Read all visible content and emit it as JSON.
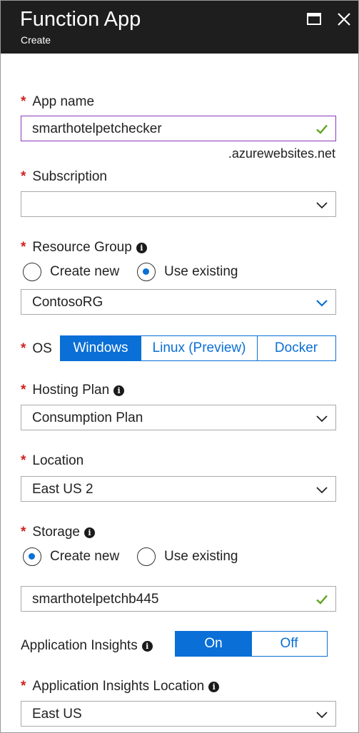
{
  "blade": {
    "title": "Function App",
    "subtitle": "Create"
  },
  "required_marker": "*",
  "info_glyph": "i",
  "app_name": {
    "label": "App name",
    "value": "smarthotelpetchecker",
    "suffix": ".azurewebsites.net"
  },
  "subscription": {
    "label": "Subscription",
    "value": ""
  },
  "resource_group": {
    "label": "Resource Group",
    "options": [
      "Create new",
      "Use existing"
    ],
    "selected": "Use existing",
    "value": "ContosoRG"
  },
  "os": {
    "label": "OS",
    "options": [
      "Windows",
      "Linux (Preview)",
      "Docker"
    ],
    "selected": "Windows"
  },
  "hosting_plan": {
    "label": "Hosting Plan",
    "value": "Consumption Plan"
  },
  "location": {
    "label": "Location",
    "value": "East US 2"
  },
  "storage": {
    "label": "Storage",
    "options": [
      "Create new",
      "Use existing"
    ],
    "selected": "Create new",
    "value": "smarthotelpetchb445"
  },
  "app_insights": {
    "label": "Application Insights",
    "options": [
      "On",
      "Off"
    ],
    "selected": "On"
  },
  "app_insights_location": {
    "label": "Application Insights Location",
    "value": "East US"
  },
  "colors": {
    "accent": "#0a6fd6",
    "required": "#d21f1f",
    "valid": "#5ea51f",
    "header": "#1e1e1e",
    "active_border": "#8a3ab9"
  },
  "icons": {
    "maximize": "maximize-icon",
    "close": "close-icon",
    "valid": "checkmark-icon",
    "dropdown": "chevron-down-icon",
    "info": "info-icon"
  }
}
